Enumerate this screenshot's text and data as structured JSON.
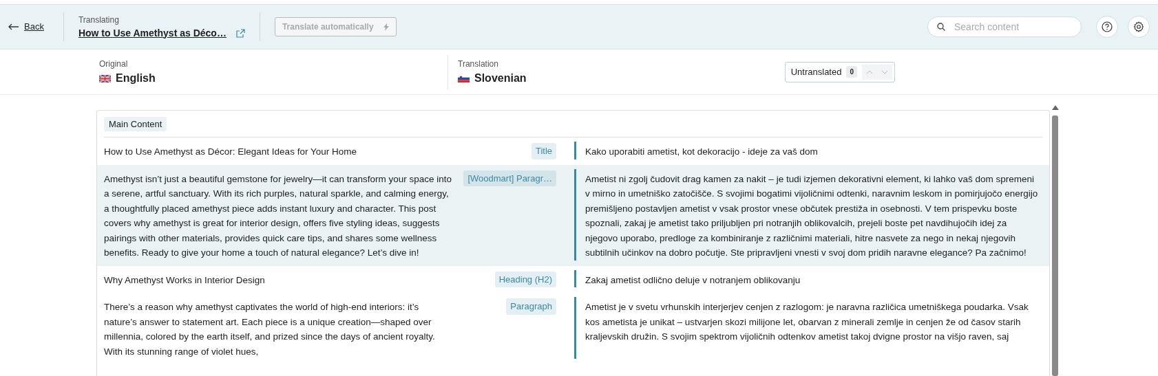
{
  "header": {
    "back": "Back",
    "context_label": "Translating",
    "page_title": "How to Use Amethyst as Déco…",
    "translate_button": {
      "label": "Translate automatically",
      "disabled": true
    },
    "search": {
      "placeholder": "Search content"
    }
  },
  "languages": {
    "original": {
      "label": "Original",
      "name": "English"
    },
    "translation": {
      "label": "Translation",
      "name": "Slovenian"
    },
    "untranslated": {
      "label": "Untranslated",
      "count": "0"
    }
  },
  "section": {
    "title": "Main Content"
  },
  "rows": [
    {
      "original": "How to Use Amethyst as Décor: Elegant Ideas for Your Home",
      "tag": "Title",
      "translation": "Kako uporabiti ametist, kot dekoracijo - ideje za vaš dom",
      "selected": false
    },
    {
      "original": "Amethyst isn’t just a beautiful gemstone for jewelry—it can transform your space into a serene, artful sanctuary. With its rich purples, natural sparkle, and calming energy, a thoughtfully placed amethyst piece adds instant luxury and character. This post covers why amethyst is great for interior design, offers five styling ideas, suggests pairings with other materials, provides quick care tips, and shares some wellness benefits. Ready to give your home a touch of natural elegance? Let’s dive in!",
      "tag": "[Woodmart] Paragr…",
      "translation": "Ametist ni zgolj čudovit drag kamen za nakit – je tudi izjemen dekorativni element, ki lahko vaš dom spremeni v mirno in umetniško zatočišče. S svojimi bogatimi vijoličnimi odtenki, naravnim leskom in pomirjujočo energijo premišljeno postavljen ametist v vsak prostor vnese občutek prestiža in osebnosti. V tem prispevku boste spoznali, zakaj je ametist tako priljubljen pri notranjih oblikovalcih, prejeli boste pet navdihujočih idej za njegovo uporabo, predloge za kombiniranje z različnimi materiali, hitre nasvete za nego in nekaj njegovih subtilnih učinkov na dobro počutje. Ste pripravljeni vnesti v svoj dom pridih naravne elegance? Pa začnimo!",
      "selected": true
    },
    {
      "original": "Why Amethyst Works in Interior Design",
      "tag": "Heading (H2)",
      "translation": "Zakaj ametist odlično deluje v notranjem oblikovanju",
      "selected": false
    },
    {
      "original": "There’s a reason why amethyst captivates the world of high-end interiors: it’s nature’s answer to statement art. Each piece is a unique creation—shaped over millennia, colored by the earth itself, and prized since the days of ancient royalty. With its stunning range of violet hues,",
      "tag": "Paragraph",
      "translation": "Ametist je v svetu vrhunskih interjerjev cenjen z razlogom: je naravna različica umetniškega poudarka. Vsak kos ametista je unikat – ustvarjen skozi milijone let, obarvan z minerali zemlje in cenjen že od časov starih kraljevskih družin. S svojim spektrom vijoličnih odtenkov ametist takoj dvigne prostor na višjo raven, saj",
      "selected": false
    }
  ]
}
